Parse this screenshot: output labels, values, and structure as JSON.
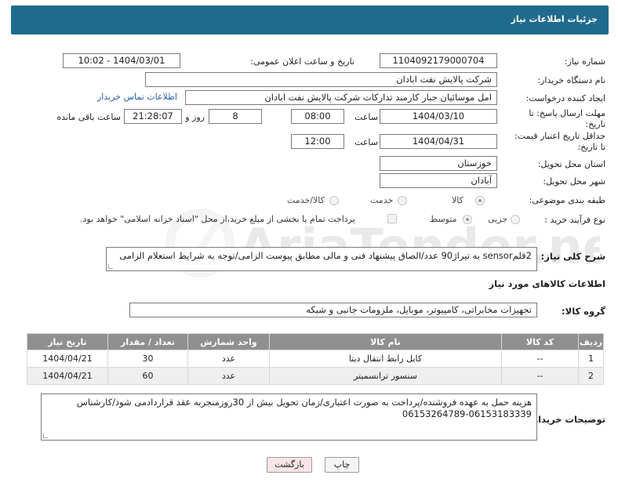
{
  "header": {
    "title": "جزئیات اطلاعات نیاز"
  },
  "fields": {
    "need_number_label": "شماره نیاز:",
    "need_number": "1104092179000704",
    "announce_label": "تاریخ و ساعت اعلان عمومی:",
    "announce_value": "1404/03/01 - 10:02",
    "buyer_org_label": "نام دستگاه خریدار:",
    "buyer_org": "شرکت پالایش نفت ابادان",
    "creator_label": "ایجاد کننده درخواست:",
    "creator": "امل موسائیان جبار کارمند تدارکات شرکت پالایش نفت ابادان",
    "contact_link": "اطلاعات تماس خریدار",
    "deadline_label_1": "مهلت ارسال پاسخ: تا",
    "deadline_label_2": "تاریخ:",
    "deadline_date": "1404/03/10",
    "time_label": "ساعت",
    "deadline_time": "08:00",
    "days": "8",
    "days_label": "روز و",
    "remaining_time": "21:28:07",
    "remaining_label": "ساعت باقی مانده",
    "validity_label_1": "حداقل تاریخ اعتبار قیمت:",
    "validity_label_2": "تا تاریخ:",
    "validity_date": "1404/04/31",
    "validity_time": "12:00",
    "province_label": "استان محل تحویل:",
    "province": "خوزستان",
    "city_label": "شهر محل تحویل:",
    "city": "آبادان",
    "category_label": "طبقه بندی موضوعی:",
    "category_options": [
      "کالا",
      "خدمت",
      "کالا/خدمت"
    ],
    "process_label": "نوع فرآیند خرید :",
    "process_options": [
      "جزیی",
      "متوسط"
    ],
    "payment_note": "پرداخت تمام یا بخشی از مبلغ خرید،از محل \"اسناد خزانه اسلامی\" خواهد بود.",
    "description_label": "شرح کلی نیاز:",
    "description": "2قلمsensor به تیراژ90 عدد/الصاق پیشنهاد فنی و مالی مطابق پیوست الزامی/توجه به شرایط استعلام الزامی"
  },
  "goods": {
    "section_title": "اطلاعات کالاهای مورد نیاز",
    "group_label": "گروه کالا:",
    "group_value": "تجهیزات مخابراتی، کامپیوتر، موبایل، ملزومات جانبی و شبکه",
    "columns": [
      "ردیف",
      "کد کالا",
      "نام کالا",
      "واحد شمارش",
      "تعداد / مقدار",
      "تاریخ نیاز"
    ],
    "rows": [
      {
        "idx": "1",
        "code": "--",
        "name": "کابل رابط انتقال دیتا",
        "unit": "عدد",
        "qty": "30",
        "date": "1404/04/21"
      },
      {
        "idx": "2",
        "code": "--",
        "name": "سنسور ترانسمیتر",
        "unit": "عدد",
        "qty": "60",
        "date": "1404/04/21"
      }
    ]
  },
  "buyer_notes": {
    "label": "توضیحات خریدار:",
    "line1": "هزینه حمل به عهده فروشنده/پرداخت به صورت اعتباری/زمان تحویل بیش از 30روزمنجربه عقد قراردادمی شود/کارشناس",
    "line2": "06153264789-06153183339"
  },
  "buttons": {
    "print": "چاپ",
    "back": "بازگشت"
  },
  "watermark_text": "AriaTender.neT"
}
